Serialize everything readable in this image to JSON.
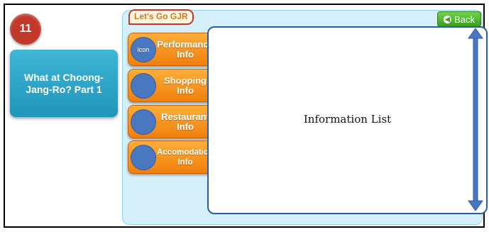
{
  "lesson": {
    "number": "11",
    "title": "What at Choong-Jang-Ro? Part 1"
  },
  "app": {
    "logo": "Let's Go GJR",
    "back_label": "Back"
  },
  "menu": [
    {
      "icon_text": "icon",
      "label": "Performance\nInfo"
    },
    {
      "icon_text": "",
      "label": "Shopping\nInfo"
    },
    {
      "icon_text": "",
      "label": "Restaurant\nInfo"
    },
    {
      "icon_text": "",
      "label": "Accomodation\nInfo"
    }
  ],
  "info_panel": {
    "title": "Information List"
  },
  "colors": {
    "menu_orange": "#f39a1e",
    "back_green": "#4fb82c",
    "panel_blue": "#d6f0fb",
    "badge_red": "#c0392b",
    "card_teal": "#2aa7cd"
  }
}
